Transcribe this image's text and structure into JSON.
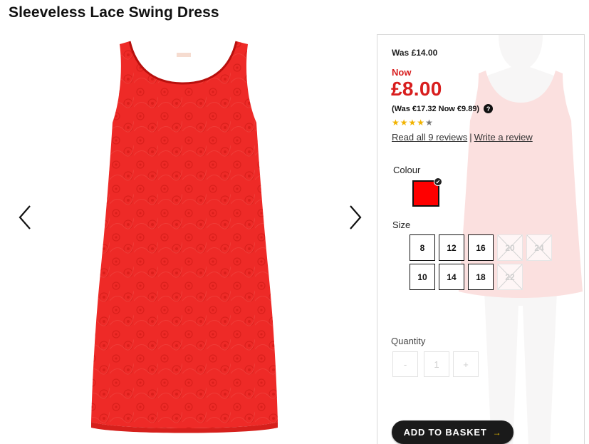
{
  "product": {
    "title": "Sleeveless Lace Swing Dress",
    "image": "red-lace-dress"
  },
  "gallery": {
    "prev_icon": "chevron-left-icon",
    "next_icon": "chevron-right-icon"
  },
  "pricing": {
    "was": "Was £14.00",
    "now_label": "Now",
    "price": "£8.00",
    "euro": "(Was €17.32 Now €9.89)",
    "help_icon": "question-circle-icon",
    "help_glyph": "?"
  },
  "rating": {
    "stars": 4,
    "max": 5,
    "star_glyph": "★",
    "read_reviews": "Read all 9 reviews",
    "separator": "|",
    "write_review": "Write a review"
  },
  "colour": {
    "label": "Colour",
    "selected_color": "#ff0000",
    "check_glyph": "✔"
  },
  "size": {
    "label": "Size",
    "options": [
      {
        "label": "8",
        "available": true
      },
      {
        "label": "12",
        "available": true
      },
      {
        "label": "16",
        "available": true
      },
      {
        "label": "20",
        "available": false
      },
      {
        "label": "24",
        "available": false
      },
      {
        "label": "10",
        "available": true
      },
      {
        "label": "14",
        "available": true
      },
      {
        "label": "18",
        "available": true
      },
      {
        "label": "22",
        "available": false
      }
    ]
  },
  "quantity": {
    "label": "Quantity",
    "minus": "-",
    "value": "1",
    "plus": "+"
  },
  "basket": {
    "label": "ADD TO BASKET",
    "arrow": "→"
  },
  "colors": {
    "accent_red": "#d81e1e",
    "dress_red": "#ee2a27",
    "star_gold": "#f1b300",
    "button_dark": "#1a1a1a"
  }
}
